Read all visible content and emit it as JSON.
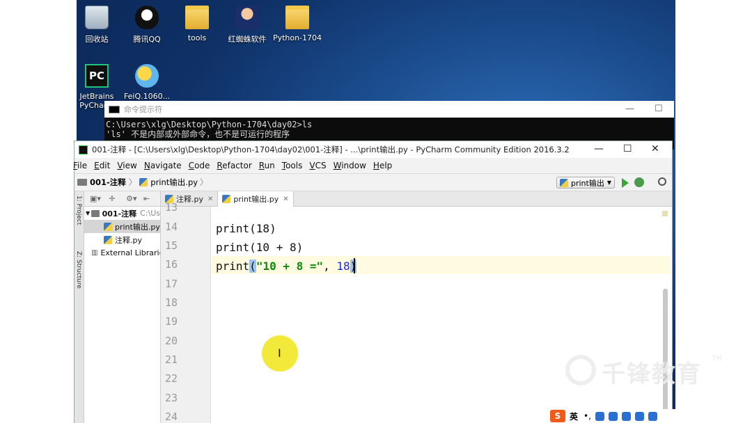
{
  "desktop": {
    "icons": [
      {
        "label": "回收站",
        "icon": "recycle-bin-icon"
      },
      {
        "label": "腾讯QQ",
        "icon": "qq-icon"
      },
      {
        "label": "tools",
        "icon": "folder-icon"
      },
      {
        "label": "红蜘蛛软件",
        "icon": "person-icon"
      },
      {
        "label": "Python-1704",
        "icon": "folder-icon"
      },
      {
        "label": "JetBrains PyCharm",
        "icon": "pycharm-icon"
      },
      {
        "label": "FeiQ.1060...",
        "icon": "feiq-icon"
      }
    ]
  },
  "cmd": {
    "title": "命令提示符",
    "line1": "C:\\Users\\xlg\\Desktop\\Python-1704\\day02>ls",
    "line2": "'ls' 不是内部或外部命令，也不是可运行的程序"
  },
  "ide": {
    "title": "001-注释 - [C:\\Users\\xlg\\Desktop\\Python-1704\\day02\\001-注释] - ...\\print输出.py - PyCharm Community Edition 2016.3.2",
    "menu": [
      "File",
      "Edit",
      "View",
      "Navigate",
      "Code",
      "Refactor",
      "Run",
      "Tools",
      "VCS",
      "Window",
      "Help"
    ],
    "breadcrumb": [
      "001-注释",
      "print输出.py"
    ],
    "run_config": "print输出",
    "sidebar_labels": [
      "1: Project",
      "Z: Structure"
    ],
    "project_tree": {
      "root": "001-注释",
      "root_path": "C:\\Us",
      "files": [
        "print输出.py",
        "注释.py"
      ],
      "external": "External Libraries"
    },
    "tabs": [
      {
        "label": "注释.py",
        "active": false
      },
      {
        "label": "print输出.py",
        "active": true
      }
    ],
    "line_numbers": [
      "13",
      "14",
      "15",
      "16",
      "17",
      "18",
      "19",
      "20",
      "21",
      "22",
      "23",
      "24"
    ],
    "code_lines": {
      "l14": "print(18)",
      "l15": "print(10 + 8)",
      "l16_prefix": "print",
      "l16_open": "(",
      "l16_string": "\"10 + 8 =\"",
      "l16_sep": ", ",
      "l16_num": "18",
      "l16_close": ")"
    }
  },
  "cursor_glyph": "I",
  "watermark": {
    "text": "千锋教育",
    "tm": "TM"
  },
  "ime": {
    "logo": "S",
    "mode": "英"
  },
  "colors": {
    "string": "#0a8a0a",
    "number": "#1a2bd6",
    "bracket_highlight": "#9dc5f0",
    "current_line": "#fffbe0",
    "cursor_spot": "#f2e93a"
  }
}
